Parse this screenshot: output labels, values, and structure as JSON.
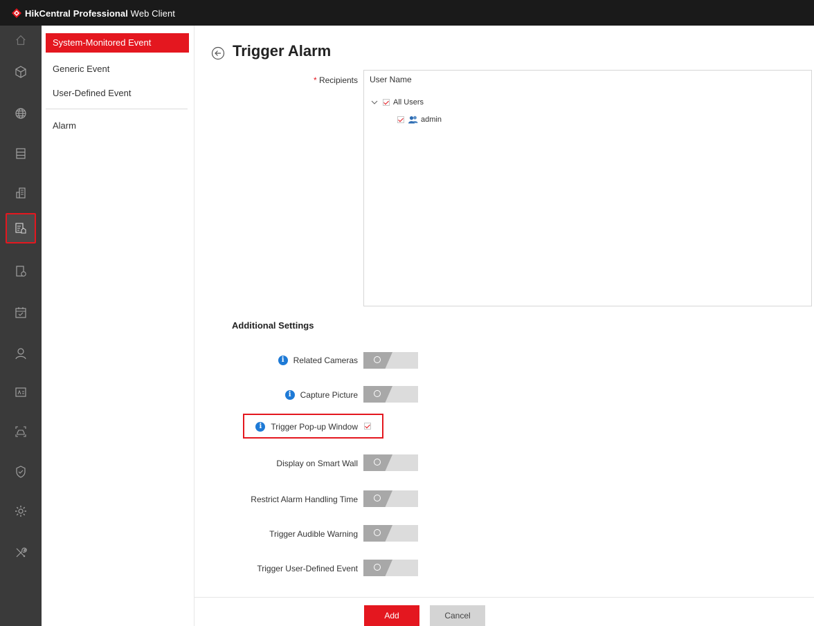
{
  "app": {
    "title_bold": "HikCentral Professional",
    "title_light": " Web Client"
  },
  "rail": {
    "items": [
      "home-icon",
      "cube-icon",
      "globe-icon",
      "server-icon",
      "building-icon",
      "event-config-icon",
      "record-schedule-icon",
      "calendar-icon",
      "person-icon",
      "id-card-icon",
      "vehicle-icon",
      "shield-icon",
      "settings-icon",
      "tools-icon"
    ],
    "active": "event-config-icon"
  },
  "submenu": {
    "items": [
      {
        "label": "System-Monitored Event",
        "active": true
      },
      {
        "label": "Generic Event",
        "active": false
      },
      {
        "label": "User-Defined Event",
        "active": false
      },
      {
        "label": "Alarm",
        "active": false
      }
    ]
  },
  "page": {
    "title": "Trigger Alarm",
    "recipients_label": "Recipients",
    "recipients_required": "*",
    "recipients_header": "User Name",
    "tree": {
      "root": {
        "label": "All Users",
        "checked": true,
        "expanded": true
      },
      "children": [
        {
          "label": "admin",
          "checked": true
        }
      ]
    },
    "additional_title": "Additional Settings",
    "settings": [
      {
        "label": "Related Cameras",
        "info": true,
        "control": "toggle",
        "on": false
      },
      {
        "label": "Capture Picture",
        "info": true,
        "control": "toggle",
        "on": false
      },
      {
        "label": "Trigger Pop-up Window",
        "info": true,
        "control": "checkbox",
        "checked": true
      },
      {
        "label": "Display on Smart Wall",
        "info": false,
        "control": "toggle",
        "on": false
      },
      {
        "label": "Restrict Alarm Handling Time",
        "info": false,
        "control": "toggle",
        "on": false
      },
      {
        "label": "Trigger Audible Warning",
        "info": false,
        "control": "toggle",
        "on": false
      },
      {
        "label": "Trigger User-Defined Event",
        "info": false,
        "control": "toggle",
        "on": false
      }
    ],
    "info_glyph": "i",
    "buttons": {
      "add": "Add",
      "cancel": "Cancel"
    }
  },
  "colors": {
    "accent": "#e4171f",
    "info": "#1e7ad6",
    "rail": "#3a3a3a",
    "topbar": "#1a1a1a"
  }
}
